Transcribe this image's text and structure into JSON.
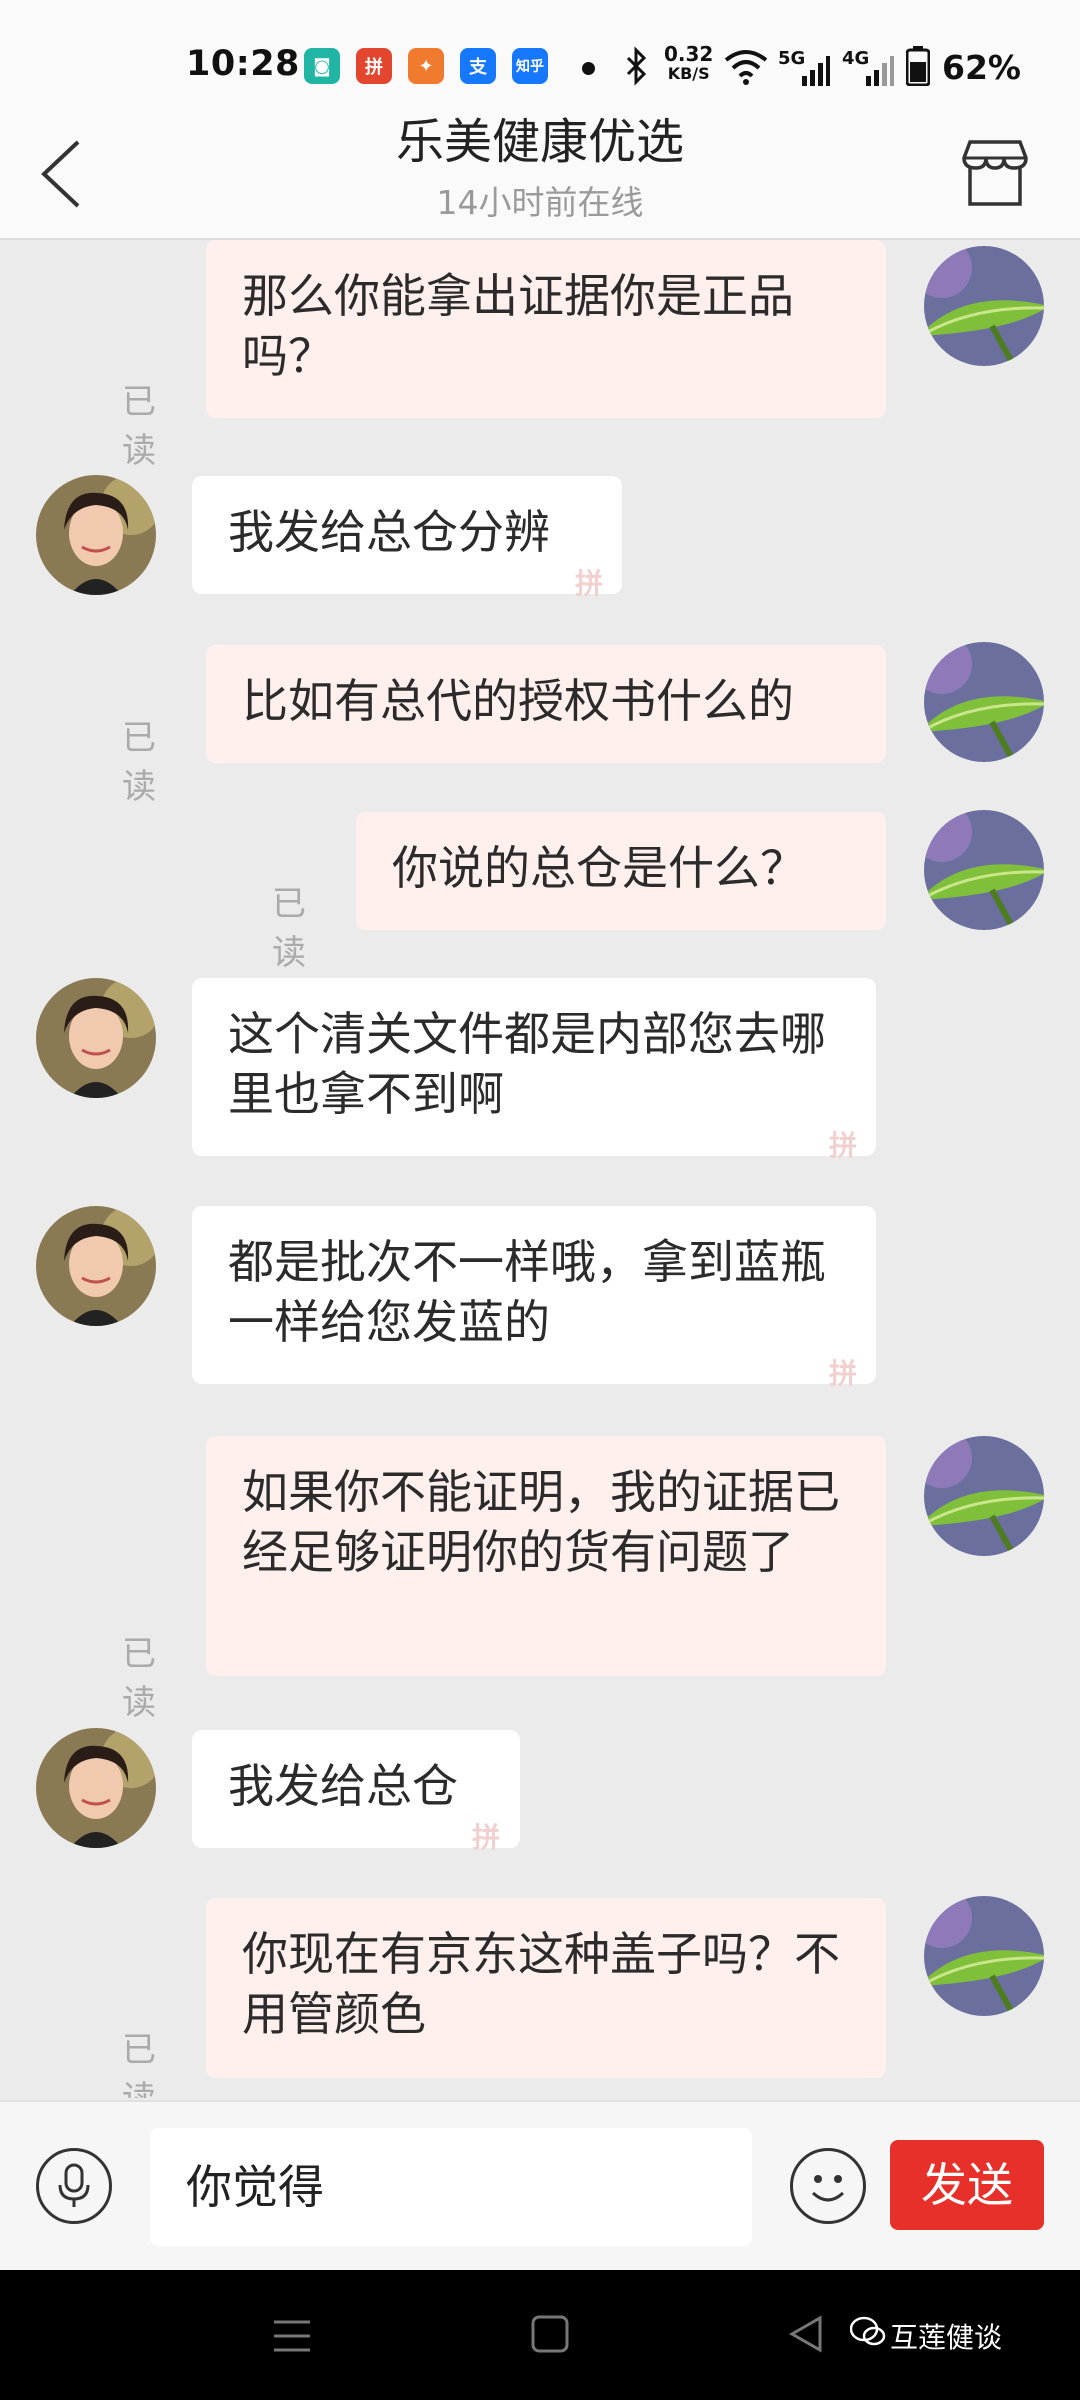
{
  "status": {
    "time": "10:28",
    "speed_value": "0.32",
    "speed_unit": "KB/S",
    "net1": "5G",
    "net2": "4G",
    "battery": "62%",
    "app_icons": [
      "mi-home-icon",
      "pinduoduo-icon",
      "taobao-icon",
      "alipay-icon",
      "zhihu-icon"
    ]
  },
  "header": {
    "title": "乐美健康优选",
    "subtitle": "14小时前在线"
  },
  "messages": [
    {
      "side": "me",
      "text": "那么你能拿出证据你是正品吗？",
      "read": "已读"
    },
    {
      "side": "other",
      "text": "我发给总仓分辨"
    },
    {
      "side": "me",
      "text": "比如有总代的授权书什么的",
      "read": "已读"
    },
    {
      "side": "me",
      "text": "你说的总仓是什么？",
      "read": "已读"
    },
    {
      "side": "other",
      "text": "这个清关文件都是内部您去哪里也拿不到啊"
    },
    {
      "side": "other",
      "text": "都是批次不一样哦，拿到蓝瓶一样给您发蓝的"
    },
    {
      "side": "me",
      "text": "如果你不能证明，我的证据已经足够证明你的货有问题了",
      "read": "已读"
    },
    {
      "side": "other",
      "text": "我发给总仓"
    },
    {
      "side": "me",
      "text": "你现在有京东这种盖子吗？不用管颜色",
      "read": "已读"
    }
  ],
  "composer": {
    "value": "你觉得",
    "send_label": "发送"
  },
  "watermark": "互莲健谈",
  "colors": {
    "send": "#e8302a",
    "my_bubble": "#fff0ee",
    "other_bubble": "#ffffff"
  }
}
